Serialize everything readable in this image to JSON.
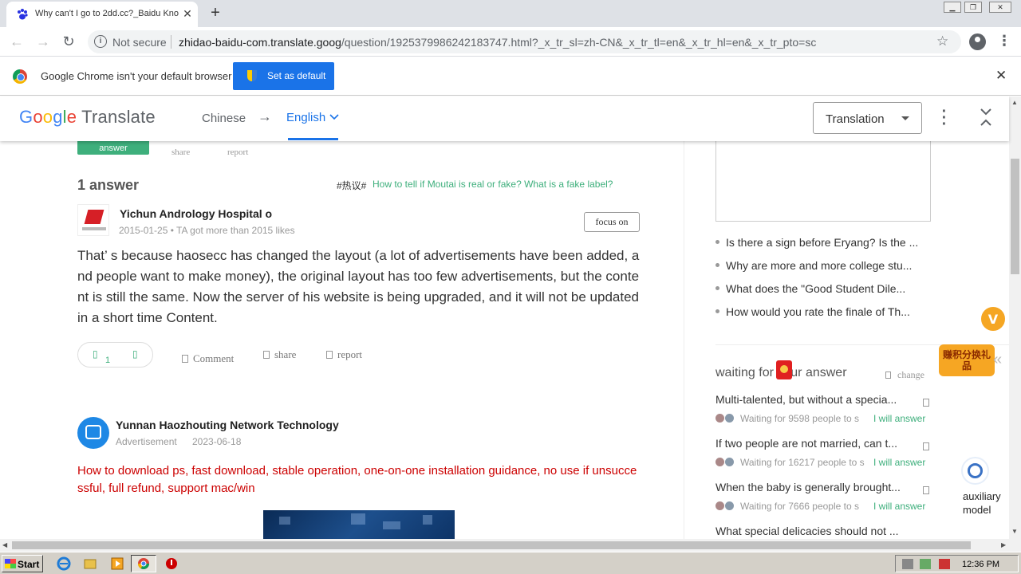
{
  "browser": {
    "tab_title": "Why can't I go to 2dd.cc?_Baidu Kno",
    "tab_close": "✕",
    "new_tab": "+",
    "security_label": "Not secure",
    "url_host": "zhidao-baidu-com.translate.goog",
    "url_path": "/question/1925379986242183747.html?_x_tr_sl=zh-CN&_x_tr_tl=en&_x_tr_hl=en&_x_tr_pto=sc"
  },
  "infobar": {
    "message": "Google Chrome isn't your default browser",
    "button": "Set as default",
    "close": "✕"
  },
  "translate": {
    "logo_g": "G",
    "logo_o1": "o",
    "logo_o2": "o",
    "logo_g2": "g",
    "logo_l": "l",
    "logo_e": "e",
    "logo_suffix": "Translate",
    "source_lang": "Chinese",
    "arrow": "→",
    "target_lang": "English",
    "mode": "Translation"
  },
  "answer_section": {
    "top_share": "share",
    "top_report": "report",
    "top_badge": "answer",
    "count_label": "1 answer",
    "hot_tag": "#热议#",
    "hot_link": "How to tell if Moutai is real or fake? What is a fake label?",
    "author": "Yichun Andrology Hospital o",
    "meta": "2015-01-25 • TA got more than 2015 likes",
    "focus_button": "focus on",
    "text": "That’ s because haosecc has changed the layout (a lot of advertisements have been added, and people want to make money), the original layout has too few advertisements, but the content is still the same. Now the server of his website is being upgraded, and it will not be updated in a short time Content.",
    "likes": "1",
    "comment": "Comment",
    "share": "share",
    "report": "report"
  },
  "ad": {
    "name": "Yunnan Haozhouting Network Technology",
    "label": "Advertisement",
    "date": "2023-06-18",
    "text": "How to download ps, fast download, stable operation, one-on-one installation guidance, no use if unsuccessful, full refund, support mac/win"
  },
  "sidebar": {
    "related": [
      "Is there a sign before Eryang? Is the ...",
      "Why are more and more college stu...",
      "What does the \"Good Student Dile...",
      "How would you rate the finale of Th..."
    ],
    "waiting_title": "waiting for your answer",
    "change": "change",
    "questions": [
      {
        "title": "Multi-talented, but without a specia...",
        "meta": "Waiting for 9598  people to s",
        "will": "I will answer"
      },
      {
        "title": "If two people are not married, can t...",
        "meta": "Waiting for 16217  people to s",
        "will": "I will answer"
      },
      {
        "title": "When the baby is generally brought...",
        "meta": "Waiting for 7666  people to s",
        "will": "I will answer"
      },
      {
        "title": "What special delicacies should not ...",
        "meta": "",
        "will": ""
      }
    ],
    "promo_text": "赚积分换礼品",
    "assist_label": "auxiliary model",
    "collapse": "«"
  },
  "taskbar": {
    "start": "Start",
    "clock": "12:36 PM"
  }
}
